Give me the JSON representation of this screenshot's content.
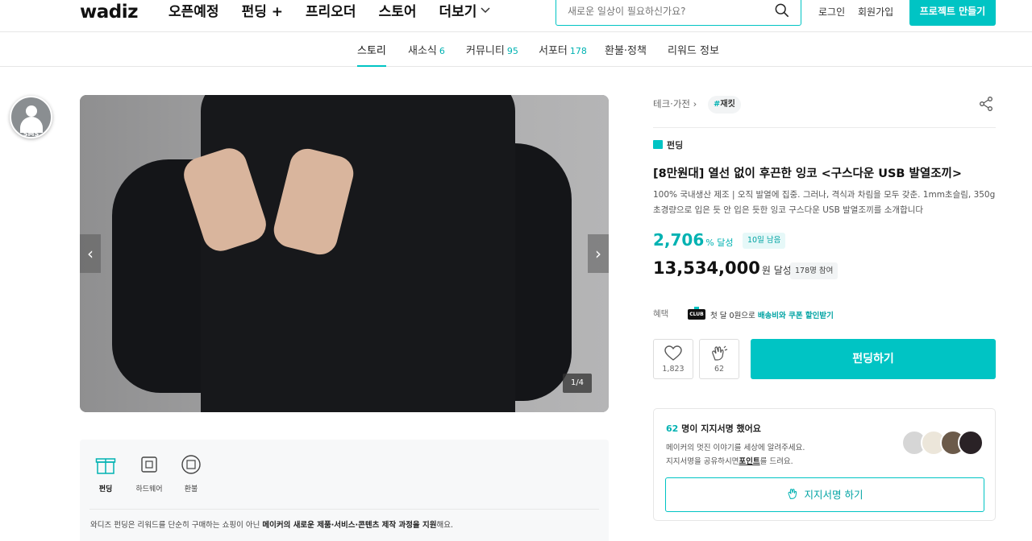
{
  "header": {
    "logo": "wadiz",
    "nav": [
      "오픈예정",
      "펀딩 +",
      "프리오더",
      "스토어"
    ],
    "more_label": "더보기",
    "search_placeholder": "새로운 일상이 필요하신가요?",
    "login_label": "로그인",
    "signup_label": "회원가입",
    "make_project_label": "프로젝트 만들기"
  },
  "tabs": {
    "story": "스토리",
    "news": "새소식",
    "news_count": "6",
    "community": "커뮤니티",
    "community_count": "95",
    "supporters": "서포터",
    "supporters_count": "178",
    "refund": "환불·정책",
    "reward": "리워드 정보"
  },
  "floating": {
    "sms_label": "SMS"
  },
  "gallery": {
    "pager": "1/4",
    "prev_arrow": "‹",
    "next_arrow": "›"
  },
  "info_strip": {
    "items": [
      "펀딩",
      "하드웨어",
      "환불"
    ],
    "desc_pre": "와디즈 펀딩은 리워드를 단순히 구매하는 쇼핑이 아닌 ",
    "desc_bold": "메이커의 새로운 제품·서비스·콘텐츠 제작 과정을 지원",
    "desc_post": "해요."
  },
  "project": {
    "category": "테크·가전",
    "category_arrow": "›",
    "tag_hash": "#",
    "tag": "재킷",
    "type_label": "펀딩",
    "title": "[8만원대] 열선 없이 후끈한 잉코 <구스다운 USB 발열조끼>",
    "description": "100% 국내생산 제조 | 오직 발열에 집중. 그러나, 격식과 차림을 모두 갖춘. 1mm초슬림, 350g초경량으로 입은 듯 안 입은 듯한 잉코 구스다운 USB 발열조끼를 소개합니다",
    "rate": "2,706",
    "rate_unit": "% 달성",
    "days_left": "10일 남음",
    "amount": "13,534,000",
    "amount_unit": "원 달성",
    "backers": "178명 참여",
    "benefit_label": "혜택",
    "club_badge": "CLUB",
    "benefit_pre": "첫 달 0원으로 ",
    "benefit_bold": "배송비와 쿠폰 할인받기",
    "like_count": "1,823",
    "cheer_count": "62",
    "fund_button": "펀딩하기"
  },
  "signature": {
    "count": "62",
    "head_suffix": " 명이 지지서명 했어요",
    "line1": "메이커의 멋진 이야기를 세상에 알려주세요.",
    "line2_pre": "지지서명을 공유하시면",
    "line2_bold": "포인트",
    "line2_post": "를 드려요.",
    "button": "지지서명 하기"
  },
  "colors": {
    "accent": "#00c4c4",
    "accent_text": "#00b2b2"
  }
}
